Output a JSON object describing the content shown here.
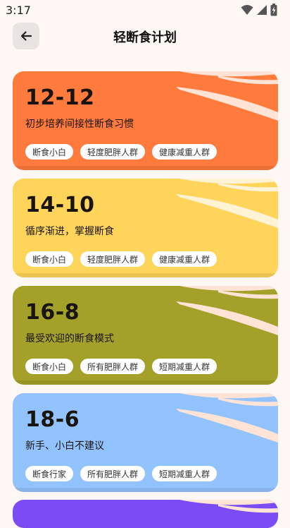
{
  "status_bar": {
    "time": "3:17",
    "icons": [
      "wifi-icon",
      "signal-icon",
      "battery-icon"
    ]
  },
  "app_bar": {
    "back_icon": "arrow-left-icon",
    "title": "轻断食计划"
  },
  "plans": [
    {
      "name": "12-12",
      "description": "初步培养间接性断食习惯",
      "color": "#FF7A3D",
      "tags": [
        "断食小白",
        "轻度肥胖人群",
        "健康减重人群"
      ]
    },
    {
      "name": "14-10",
      "description": "循序渐进，掌握断食",
      "color": "#FFD45A",
      "tags": [
        "断食小白",
        "轻度肥胖人群",
        "健康减重人群"
      ]
    },
    {
      "name": "16-8",
      "description": "最受欢迎的断食模式",
      "color": "#A3A129",
      "tags": [
        "断食小白",
        "所有肥胖人群",
        "短期减重人群"
      ]
    },
    {
      "name": "18-6",
      "description": "新手、小白不建议",
      "color": "#93C3FF",
      "tags": [
        "断食行家",
        "所有肥胖人群",
        "短期减重人群"
      ]
    }
  ],
  "peek_card": {
    "color": "#7B4CF5"
  }
}
